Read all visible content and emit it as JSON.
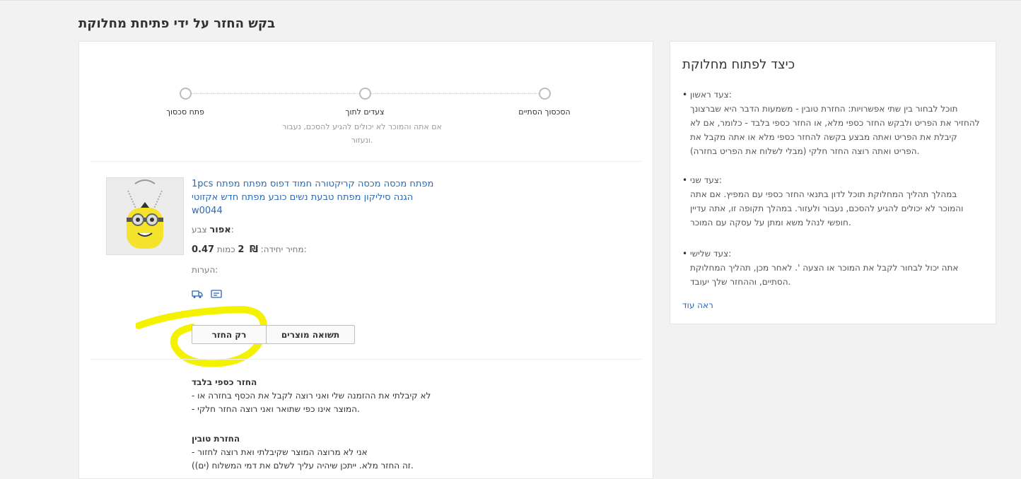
{
  "page_title": "בקש החזר על ידי פתיחת מחלוקת",
  "steps": [
    {
      "label": "פתח סכסוך",
      "desc": ""
    },
    {
      "label": "צעדים לתוך",
      "desc": "אם אתה והמוכר לא יכולים להגיע להסכם, נעבור ונעזור."
    },
    {
      "label": "הסכסוך הסתיים",
      "desc": ""
    }
  ],
  "product": {
    "title": "1pcs מפתח מכסה מכסה קריקטורה חמוד דפוס מפתח מפתח הגנה סיליקון מפתח טבעת נשים כובע מפתח חדש אקזוטי w0044",
    "color_label": "צבע:",
    "color_value": "אפור",
    "unit_price_label": "מחיר יחידה:",
    "unit_price_value": "0.47",
    "currency": "₪",
    "qty_label": "כמות:",
    "qty_value": "2",
    "notes_label": "הערות:"
  },
  "buttons": {
    "refund_only": "רק החזר",
    "return_products": "תשואה מוצרים"
  },
  "refund_only_info": {
    "title": "החזר כספי בלבד",
    "lines": [
      "- לא קיבלתי את ההזמנה שלי ואני רוצה לקבל את הכסף בחזרה או",
      "- המוצר אינו כפי שתואר ואני רוצה החזר חלקי."
    ]
  },
  "return_info": {
    "title": "החזרת טובין",
    "lines": [
      "- אני לא מרוצה המוצר שקיבלתי ואת רוצה לחזור",
      "(זה החזר מלא. ייתכן שיהיה עליך לשלם את דמי המשלוח (ים)."
    ]
  },
  "side": {
    "title": "כיצד לפתוח מחלוקת",
    "steps": [
      {
        "label": "צעד ראשון:",
        "text": "תוכל לבחור בין שתי אפשרויות: החזרת טובין - משמעות הדבר היא שברצונך להחזיר את הפריט ולבקש החזר כספי מלא, או החזר כספי בלבד - כלומר, אם לא קיבלת את הפריט ואתה מבצע בקשה להחזר כספי מלא או אתה מקבל את הפריט ואתה רוצה החזר חלקי (מבלי לשלוח את הפריט בחזרה)."
      },
      {
        "label": "צעד שני:",
        "text": "במהלך תהליך המחלוקת תוכל לדון בתנאי החזר כספי עם המפיץ. אם אתה והמוכר לא יכולים להגיע להסכם, נעבור ולעזור. במהלך תקופה זו, אתה עדיין חופשי לנהל משא ומתן על עסקה עם המוכר."
      },
      {
        "label": "צעד שלישי:",
        "text": "אתה יכול לבחור לקבל את המוכר או הצעה '. לאחר מכן, תהליך המחלוקת הסתיים, וההחזר שלך יעובד."
      }
    ],
    "see_more": "ראה עוד"
  },
  "colors": {
    "link": "#2a6ab6",
    "highlight": "#f5f200",
    "background": "#f2f2f2"
  }
}
